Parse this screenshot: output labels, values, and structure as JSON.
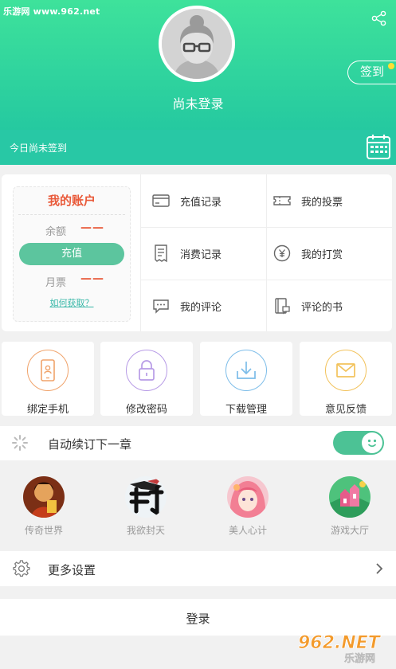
{
  "watermark": "乐游网 www.962.net",
  "header": {
    "login_status": "尚未登录",
    "signin_label": "签到",
    "sign_status": "今日尚未签到"
  },
  "account": {
    "title": "我的账户",
    "balance_label": "余额",
    "balance_value": "——",
    "recharge_label": "充值",
    "monthly_ticket_label": "月票",
    "monthly_ticket_value": "——",
    "how_to_get": "如何获取？"
  },
  "grid": [
    {
      "label": "充值记录",
      "icon": "card-icon"
    },
    {
      "label": "我的投票",
      "icon": "ticket-icon"
    },
    {
      "label": "消费记录",
      "icon": "receipt-icon"
    },
    {
      "label": "我的打赏",
      "icon": "coin-icon"
    },
    {
      "label": "我的评论",
      "icon": "comment-icon"
    },
    {
      "label": "评论的书",
      "icon": "book-icon"
    }
  ],
  "tiles": [
    {
      "label": "绑定手机",
      "icon": "phone-icon",
      "color": "#f0a36b"
    },
    {
      "label": "修改密码",
      "icon": "lock-icon",
      "color": "#b79be6"
    },
    {
      "label": "下载管理",
      "icon": "download-icon",
      "color": "#7dbde9"
    },
    {
      "label": "意见反馈",
      "icon": "mail-icon",
      "color": "#f2c25b"
    }
  ],
  "auto_subscribe": {
    "label": "自动续订下一章",
    "enabled": true
  },
  "games": [
    {
      "label": "传奇世界"
    },
    {
      "label": "我欲封天"
    },
    {
      "label": "美人心计"
    },
    {
      "label": "游戏大厅"
    }
  ],
  "settings_label": "更多设置",
  "login_label": "登录",
  "logo_text": {
    "brand": "962.NET",
    "sub": "乐游网"
  },
  "colors": {
    "accent": "#3ee29b",
    "red": "#e95a3a",
    "teal": "#28c8a5"
  }
}
